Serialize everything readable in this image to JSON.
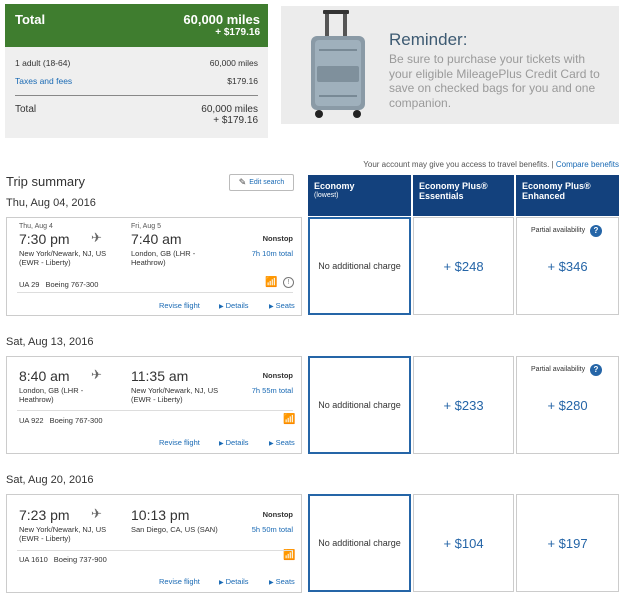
{
  "total": {
    "label": "Total",
    "miles": "60,000 miles",
    "fees": "+ $179.16",
    "rows": [
      {
        "label": "1 adult (18-64)",
        "value": "60,000 miles"
      },
      {
        "label": "Taxes and fees",
        "value": "$179.16"
      }
    ],
    "bottom_label": "Total",
    "bottom_miles": "60,000 miles",
    "bottom_fees": "+ $179.16"
  },
  "reminder": {
    "title": "Reminder:",
    "text": "Be sure to purchase your tickets with your eligible MileagePlus Credit Card to save on checked bags for you and one companion."
  },
  "account_note": {
    "text": "Your account may give you access to travel benefits. |",
    "link": "Compare benefits"
  },
  "trip": {
    "title": "Trip summary",
    "edit_label": "Edit search"
  },
  "cabins": [
    {
      "name": "Economy",
      "sub": "(lowest)"
    },
    {
      "name": "Economy Plus®",
      "sub": "Essentials"
    },
    {
      "name": "Economy Plus®",
      "sub": "Enhanced"
    }
  ],
  "segments": [
    {
      "date_label": "Thu, Aug 04, 2016",
      "dep_small_date": "Thu, Aug 4",
      "arr_small_date": "Fri, Aug 5",
      "dep_time": "7:30 pm",
      "arr_time": "7:40 am",
      "dep_city": "New York/Newark, NJ, US (EWR - Liberty)",
      "arr_city": "London, GB (LHR - Heathrow)",
      "stops": "Nonstop",
      "duration": "7h 10m total",
      "flight_no": "UA 29",
      "aircraft": "Boeing 767-300",
      "revise": "Revise flight",
      "details": "Details",
      "seats": "Seats",
      "economy": "No additional charge",
      "essentials": "+ $248",
      "enhanced": "+ $346",
      "enhanced_note": "Partial availability"
    },
    {
      "date_label": "Sat, Aug 13, 2016",
      "dep_time": "8:40 am",
      "arr_time": "11:35 am",
      "dep_city": "London, GB (LHR - Heathrow)",
      "arr_city": "New York/Newark, NJ, US (EWR - Liberty)",
      "stops": "Nonstop",
      "duration": "7h 55m total",
      "flight_no": "UA 922",
      "aircraft": "Boeing 767-300",
      "revise": "Revise flight",
      "details": "Details",
      "seats": "Seats",
      "economy": "No additional charge",
      "essentials": "+ $233",
      "enhanced": "+ $280",
      "enhanced_note": "Partial availability"
    },
    {
      "date_label": "Sat, Aug 20, 2016",
      "dep_time": "7:23 pm",
      "arr_time": "10:13 pm",
      "dep_city": "New York/Newark, NJ, US (EWR - Liberty)",
      "arr_city": "San Diego, CA, US (SAN)",
      "stops": "Nonstop",
      "duration": "5h 50m total",
      "flight_no": "UA 1610",
      "aircraft": "Boeing 737-900",
      "revise": "Revise flight",
      "details": "Details",
      "seats": "Seats",
      "economy": "No additional charge",
      "essentials": "+ $104",
      "enhanced": "+ $197"
    }
  ],
  "colors": {
    "total_header": "#3f7d2f",
    "cabin_header": "#13417d",
    "link": "#1a6ab4",
    "price": "#2565a7"
  },
  "icons": {
    "plane": "airplane-icon",
    "wifi": "wifi-icon",
    "info": "info-icon",
    "edit": "pencil-icon",
    "help": "question-icon"
  }
}
